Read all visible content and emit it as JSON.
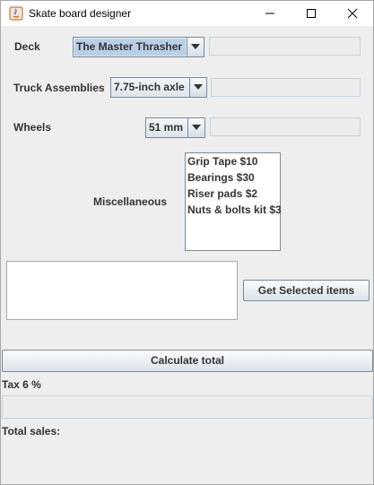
{
  "window": {
    "title": "Skate board designer"
  },
  "deck": {
    "label": "Deck",
    "selected": "The Master Thrasher",
    "price_text": ""
  },
  "trucks": {
    "label": "Truck Assemblies",
    "selected": "7.75-inch axle",
    "price_text": ""
  },
  "wheels": {
    "label": "Wheels",
    "selected": "51 mm",
    "price_text": ""
  },
  "misc": {
    "label": "Miscellaneous",
    "items": [
      "Grip Tape  $10",
      "Bearings $30",
      "Riser pads $2",
      "Nuts & bolts kit $3"
    ]
  },
  "selected_items_text": "",
  "buttons": {
    "get_selected": "Get Selected items",
    "calculate": "Calculate total"
  },
  "tax": {
    "label": "Tax 6 %",
    "value": ""
  },
  "total": {
    "label": "Total sales:",
    "value": ""
  },
  "colors": {
    "selection": "#b8cfe5",
    "button_border": "#7a8a99",
    "window_bg": "#eeeeee"
  }
}
